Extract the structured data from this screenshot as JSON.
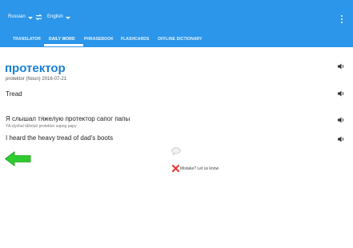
{
  "header": {
    "from_language": "Russian",
    "to_language": "English",
    "swap_icon": "swap-arrows-icon",
    "menu_icon": "more-vert-icon"
  },
  "tabs": [
    {
      "label": "TRANSLATOR",
      "active": false
    },
    {
      "label": "DAILY WORD",
      "active": true
    },
    {
      "label": "PHRASEBOOK",
      "active": false
    },
    {
      "label": "FLASHCARDS",
      "active": false
    },
    {
      "label": "OFFLINE DICTIONARY",
      "active": false
    }
  ],
  "daily_word": {
    "word": "протектор",
    "meta": "protektor (Noun) 2016-07-21",
    "translation": "Tread",
    "example": "Я слышал тяжелую протектор сапог папы",
    "example_transliteration": "YA slyshal tâželuû protektor sapog papy",
    "example_translation": "I heard the heavy tread of dad's boots"
  },
  "footer": {
    "mistake_text": "Mistake? Let us know"
  },
  "colors": {
    "appbar": "#2b96ea",
    "word": "#1a7fd0",
    "back_arrow": "#2ecc2e",
    "mistake_x": "#e53935"
  }
}
